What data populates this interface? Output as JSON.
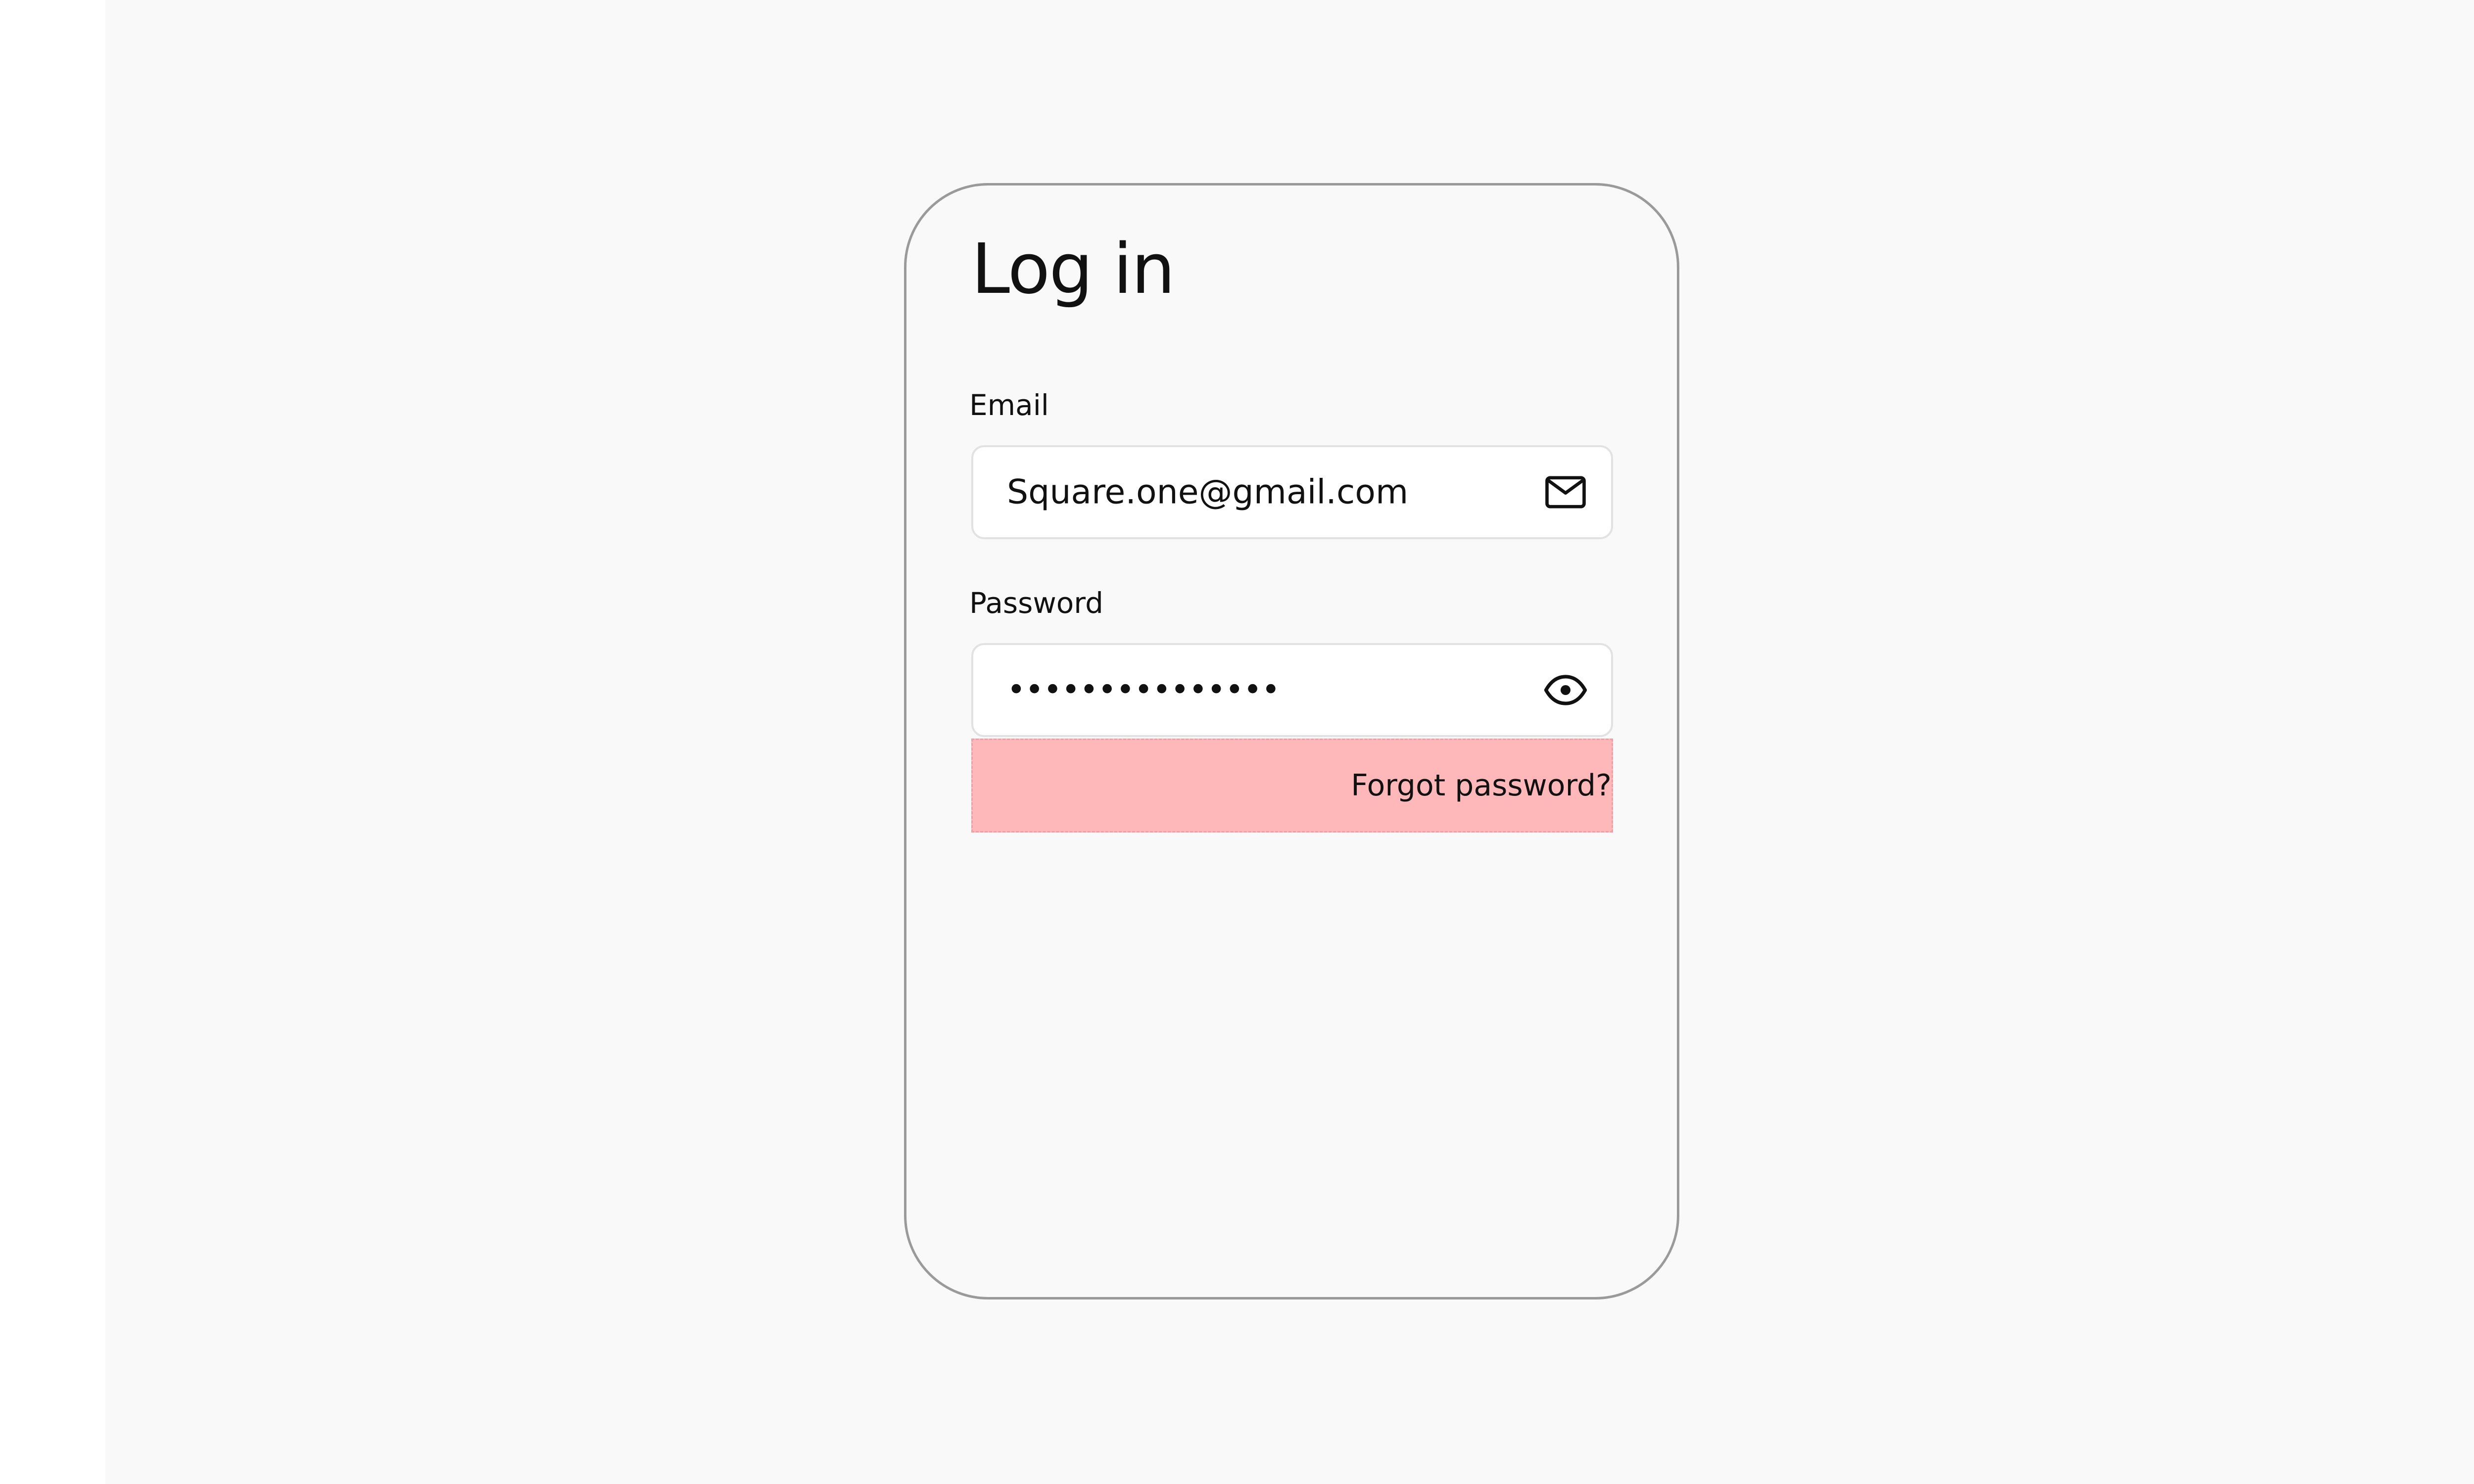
{
  "login": {
    "title": "Log in",
    "email_label": "Email",
    "email_value": "Square.one@gmail.com",
    "password_label": "Password",
    "password_value": "•••••••••••••••",
    "forgot_password": "Forgot password?"
  },
  "icons": {
    "email_field": "mail-icon",
    "password_field": "eye-icon"
  },
  "colors": {
    "background": "#f9f9f9",
    "card_border": "#9a9a9a",
    "input_background": "#ffffff",
    "highlight": "#ffb8ba",
    "text": "#111111"
  }
}
